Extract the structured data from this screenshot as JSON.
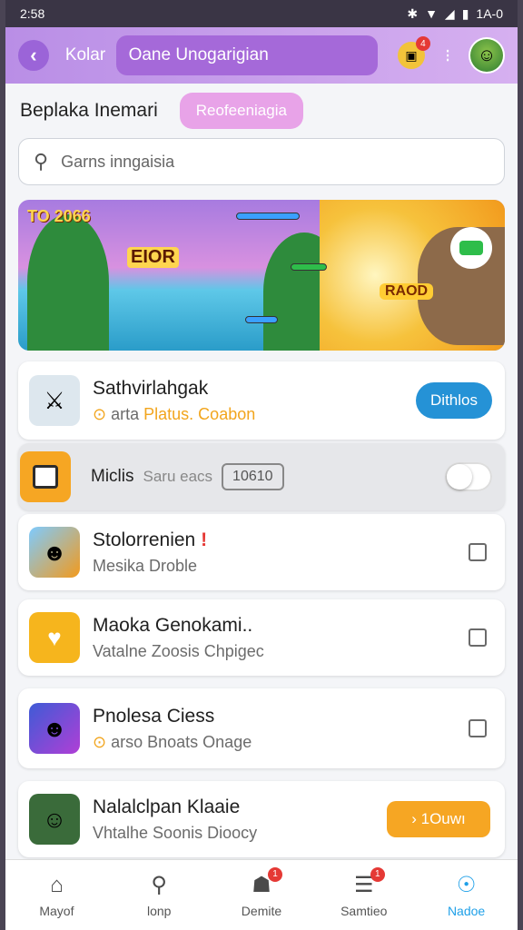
{
  "status": {
    "time": "2:58",
    "right": "1A-0"
  },
  "topbar": {
    "back_label": "Kolar",
    "search_text": "Oane Unogarigian",
    "notif_count": "4"
  },
  "section": {
    "title": "Beplaka Inemari",
    "chip": "Reofeeniagia"
  },
  "search": {
    "placeholder": "Garns inngaisia"
  },
  "banner": {
    "title": "TO 2066",
    "sub": "EIOR",
    "badge": "RAOD"
  },
  "featured": {
    "title": "Sathvirlahgak",
    "sub_prefix": "arta",
    "sub_highlight": "Platus. Coabon",
    "button": "Dithlos"
  },
  "toggle_row": {
    "label": "Miclis",
    "muted": "Saru eacs",
    "box": "10610",
    "enabled": false
  },
  "items": [
    {
      "title": "Stolorrenien",
      "sub": "Mesika Droble"
    },
    {
      "title": "Maoka Genokami..",
      "sub": "Vatalne Zoosis Chpigec"
    },
    {
      "title": "Pnolesa Ciess",
      "sub": "arso Bnoats Onage"
    },
    {
      "title": "Nalalclpan Klaaie",
      "sub": "Vhtalhe Soonis Dioocy",
      "button": "1Ouwı"
    }
  ],
  "nav": [
    {
      "label": "Mayof",
      "icon": "home-icon"
    },
    {
      "label": "lonp",
      "icon": "search-icon"
    },
    {
      "label": "Demite",
      "icon": "group-icon",
      "badge": "1"
    },
    {
      "label": "Samtieo",
      "icon": "list-icon",
      "badge": "1"
    },
    {
      "label": "Nadoe",
      "icon": "profile-icon",
      "active": true
    }
  ],
  "colors": {
    "accent": "#a569d9",
    "primary_button": "#2592d6",
    "cta": "#f6a623",
    "nav_active": "#1fa0e8"
  }
}
